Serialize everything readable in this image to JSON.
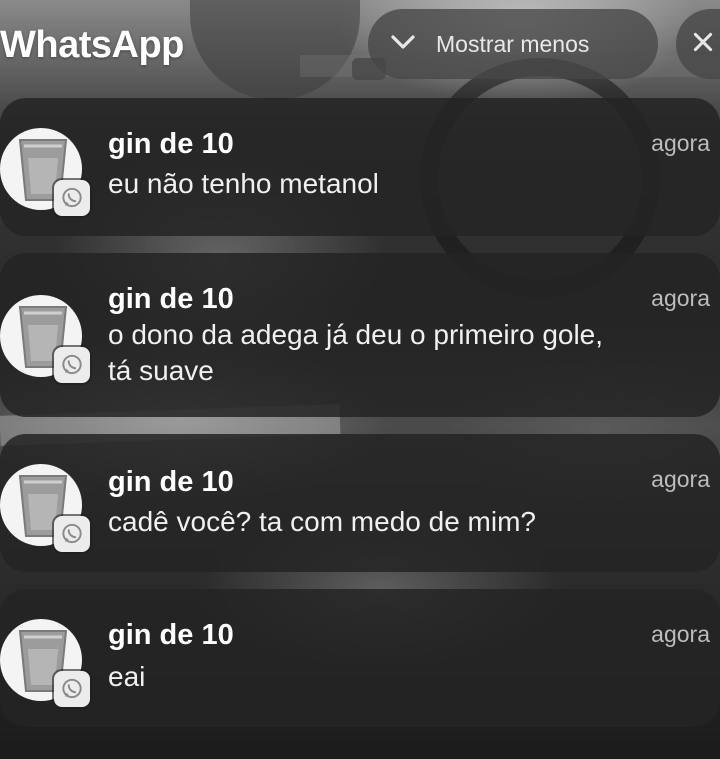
{
  "header": {
    "app_title": "WhatsApp",
    "collapse_label": "Mostrar menos"
  },
  "notifications": [
    {
      "sender": "gin de 10",
      "time": "agora",
      "message": "eu não tenho metanol"
    },
    {
      "sender": "gin de 10",
      "time": "agora",
      "message_lines": [
        "o dono da adega já deu o primeiro gole,",
        "tá suave"
      ]
    },
    {
      "sender": "gin de 10",
      "time": "agora",
      "message": "cadê você? ta com medo de mim?"
    },
    {
      "sender": "gin de 10",
      "time": "agora",
      "message": "eai"
    }
  ],
  "icons": {
    "collapse": "chevron-down-icon",
    "close": "close-icon",
    "avatar": "plastic-cup-icon",
    "badge": "whatsapp-icon"
  },
  "colors": {
    "card": "#242424",
    "pill": "#464646",
    "time": "#bdbdbd"
  }
}
